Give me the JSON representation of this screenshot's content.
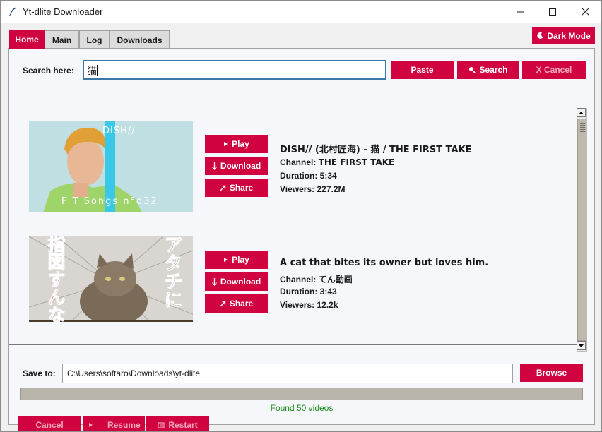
{
  "window": {
    "title": "Yt-dlite Downloader"
  },
  "tabs": [
    {
      "label": "Home",
      "active": true
    },
    {
      "label": "Main",
      "active": false
    },
    {
      "label": "Log",
      "active": false
    },
    {
      "label": "Downloads",
      "active": false
    }
  ],
  "toolbar": {
    "dark_mode_label": "Dark Mode"
  },
  "search": {
    "label": "Search here:",
    "value": "猫",
    "paste_label": "Paste",
    "search_label": "Search",
    "cancel_label": "X Cancel"
  },
  "results": [
    {
      "title": "DISH// (北村匠海) - 猫 / THE FIRST TAKE",
      "channel_label": "Channel:",
      "channel": "THE FIRST TAKE",
      "duration_label": "Duration:",
      "duration": "5:34",
      "viewers_label": "Viewers:",
      "viewers": "227.2M",
      "thumb_text_top": "DISH//",
      "thumb_text_bottom": "F T Songs n°o32",
      "play_label": "Play",
      "download_label": "Download",
      "share_label": "Share"
    },
    {
      "title": "A cat that bites its owner but loves him.",
      "channel_label": "Channel:",
      "channel": "てん動画",
      "duration_label": "Duration:",
      "duration": "3:43",
      "viewers_label": "Viewers:",
      "viewers": "12.2k",
      "thumb_text_left": "指図すんな",
      "thumb_text_right": "アタチに",
      "play_label": "Play",
      "download_label": "Download",
      "share_label": "Share"
    }
  ],
  "save": {
    "label": "Save to:",
    "path": "C:\\Users\\softaro\\Downloads\\yt-dlite",
    "browse_label": "Browse"
  },
  "progress": {
    "status": "Found 50 videos",
    "value": 0
  },
  "footer": {
    "cancel_label": "Cancel",
    "resume_label": "Resume",
    "restart_label": "Restart"
  },
  "colors": {
    "accent": "#d0023f",
    "status": "#1b8a1b"
  }
}
